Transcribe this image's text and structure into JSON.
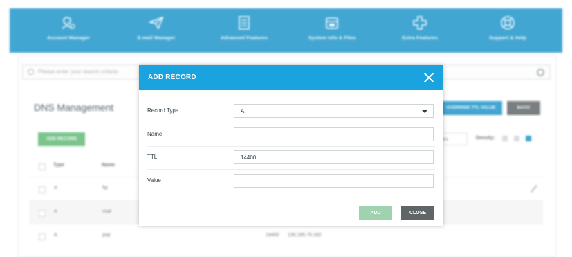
{
  "nav": [
    {
      "label": "Account Manager",
      "icon": "account-manager-icon"
    },
    {
      "label": "E-mail Manager",
      "icon": "paper-plane-icon"
    },
    {
      "label": "Advanced Features",
      "icon": "document-icon"
    },
    {
      "label": "System Info & Files",
      "icon": "folder-icon"
    },
    {
      "label": "Extra Features",
      "icon": "plus-icon"
    },
    {
      "label": "Support & Help",
      "icon": "lifebuoy-icon"
    }
  ],
  "search": {
    "placeholder": "Please enter your search criteria"
  },
  "page": {
    "title": "DNS Management",
    "ttl_button": "OVERRIDE TTL VALUE",
    "back_button": "BACK",
    "add_record_button": "ADD RECORD",
    "entries_label": "files",
    "density_label": "Density:"
  },
  "table": {
    "headers": [
      "Type",
      "Name"
    ],
    "rows": [
      {
        "type": "A",
        "name": "ftp",
        "ttl": "",
        "value": ""
      },
      {
        "type": "A",
        "name": "mail",
        "ttl": "",
        "value": ""
      },
      {
        "type": "A",
        "name": "pop",
        "ttl": "14400",
        "value": "130.185.75.182"
      }
    ]
  },
  "modal": {
    "title": "ADD RECORD",
    "fields": {
      "record_type": {
        "label": "Record Type",
        "value": "A"
      },
      "name": {
        "label": "Name",
        "value": ""
      },
      "ttl": {
        "label": "TTL",
        "value": "14400"
      },
      "value": {
        "label": "Value",
        "value": ""
      }
    },
    "add_button": "ADD",
    "close_button": "CLOSE"
  },
  "colors": {
    "header_blue": "#1993c9",
    "modal_header": "#1aa3df",
    "add_green": "#9fd3b0",
    "close_gray": "#606567"
  }
}
